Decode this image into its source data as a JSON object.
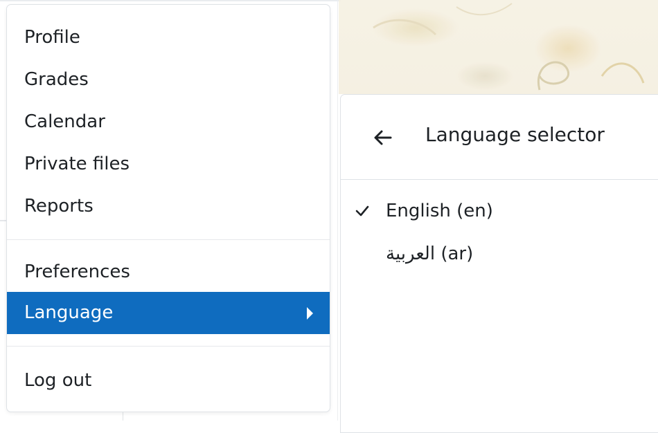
{
  "user_menu": {
    "items_group1": [
      {
        "label": "Profile"
      },
      {
        "label": "Grades"
      },
      {
        "label": "Calendar"
      },
      {
        "label": "Private files"
      },
      {
        "label": "Reports"
      }
    ],
    "items_group2": [
      {
        "label": "Preferences"
      },
      {
        "label": "Language",
        "active": true,
        "has_submenu": true
      }
    ],
    "items_group3": [
      {
        "label": "Log out"
      }
    ]
  },
  "language_panel": {
    "title": "Language selector",
    "back_icon": "arrow-left-icon",
    "languages": [
      {
        "label": "English (en)",
        "selected": true
      },
      {
        "label": "العربية (ar)",
        "selected": false
      }
    ]
  },
  "colors": {
    "accent": "#0f6cbf",
    "text": "#1d2125",
    "border": "#dee2e6"
  }
}
